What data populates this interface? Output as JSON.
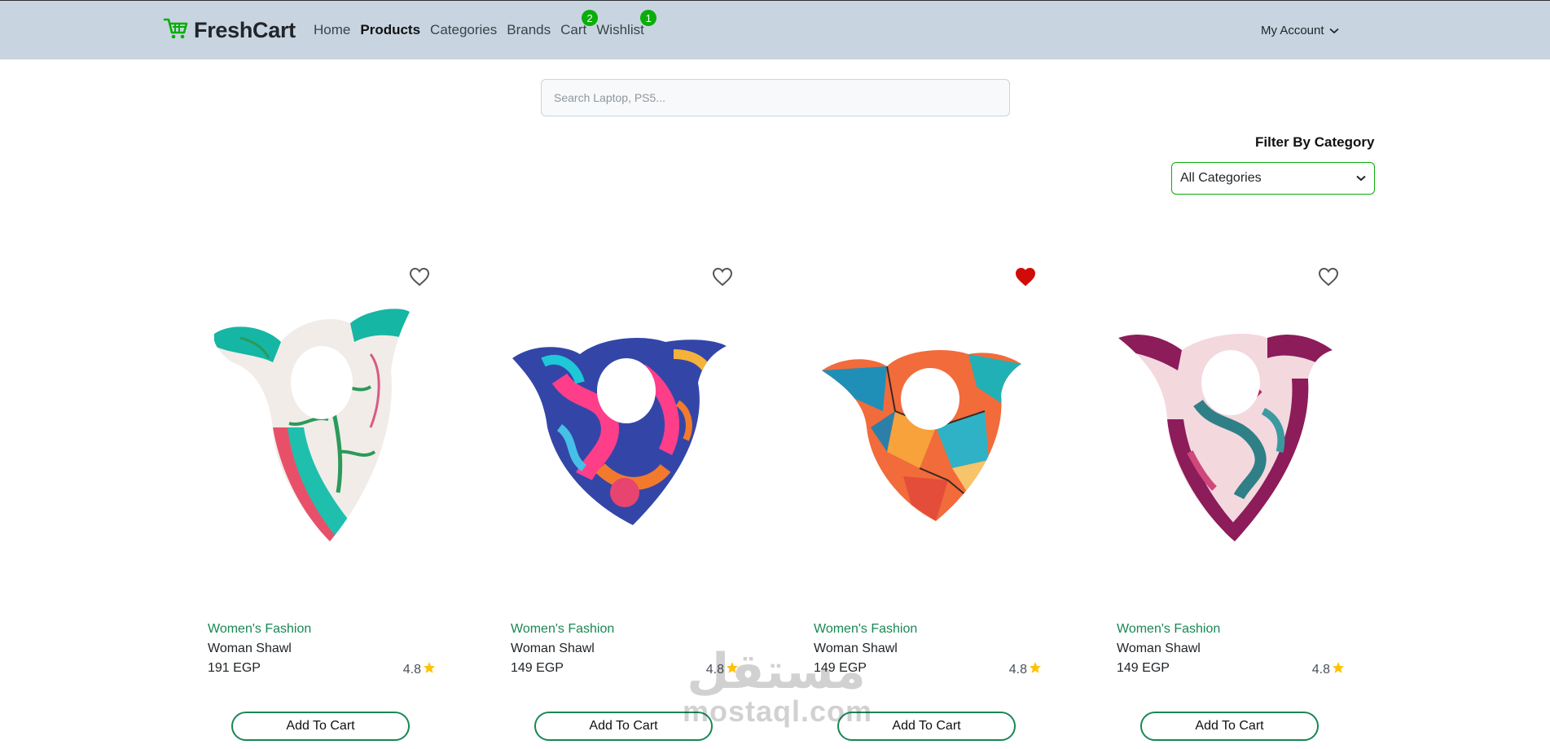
{
  "brand": {
    "name": "FreshCart",
    "icon": "cart-icon",
    "accent": "#0aad0a"
  },
  "nav": {
    "items": [
      {
        "label": "Home",
        "active": false
      },
      {
        "label": "Products",
        "active": true
      },
      {
        "label": "Categories",
        "active": false
      },
      {
        "label": "Brands",
        "active": false
      },
      {
        "label": "Cart",
        "active": false,
        "badge": "2"
      },
      {
        "label": "Wishlist",
        "active": false,
        "badge": "1"
      }
    ],
    "account_label": "My Account",
    "background": "#c8d5e0"
  },
  "search": {
    "placeholder": "Search Laptop, PS5..."
  },
  "filter": {
    "label": "Filter By Category",
    "selected": "All Categories"
  },
  "products": [
    {
      "category": "Women's Fashion",
      "name": "Woman Shawl",
      "price": "191 EGP",
      "rating": "4.8",
      "wishlisted": false,
      "button": "Add To Cart",
      "image": "floral-teal-pink-scarf"
    },
    {
      "category": "Women's Fashion",
      "name": "Woman Shawl",
      "price": "149 EGP",
      "rating": "4.8",
      "wishlisted": false,
      "button": "Add To Cart",
      "image": "navy-pink-floral-scarf"
    },
    {
      "category": "Women's Fashion",
      "name": "Woman Shawl",
      "price": "149 EGP",
      "rating": "4.8",
      "wishlisted": true,
      "button": "Add To Cart",
      "image": "orange-geometric-scarf"
    },
    {
      "category": "Women's Fashion",
      "name": "Woman Shawl",
      "price": "149 EGP",
      "rating": "4.8",
      "wishlisted": false,
      "button": "Add To Cart",
      "image": "magenta-leaf-scarf"
    }
  ],
  "watermark": {
    "arabic": "مستقل",
    "latin": "mostaql.com"
  }
}
